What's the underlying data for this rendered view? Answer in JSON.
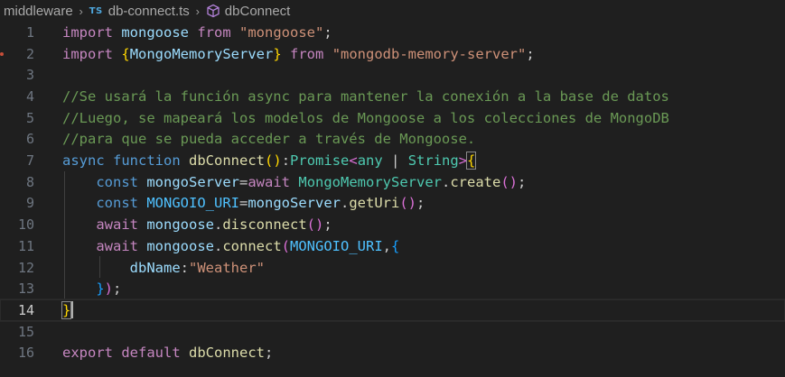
{
  "breadcrumb": {
    "folder": "middleware",
    "file_badge": "TS",
    "file": "db-connect.ts",
    "symbol": "dbConnect",
    "separator": "›"
  },
  "editor": {
    "current_line": 14,
    "line_numbers": [
      "1",
      "2",
      "3",
      "4",
      "5",
      "6",
      "7",
      "8",
      "9",
      "10",
      "11",
      "12",
      "13",
      "14",
      "15",
      "16"
    ],
    "lines": {
      "l1": {
        "t1": "import",
        "t2": " mongoose ",
        "t3": "from",
        "t4": " ",
        "t5": "\"mongoose\"",
        "t6": ";"
      },
      "l2": {
        "t1": "import",
        "t2": " ",
        "t3": "{",
        "t4": "MongoMemoryServer",
        "t5": "}",
        "t6": " ",
        "t7": "from",
        "t8": " ",
        "t9": "\"mongodb-memory-server\"",
        "t10": ";"
      },
      "l4": {
        "t1": "//Se usará la función async para mantener la conexión a la base de datos"
      },
      "l5": {
        "t1": "//Luego, se mapeará los modelos de Mongoose a los colecciones de MongoDB"
      },
      "l6": {
        "t1": "//para que se pueda acceder a través de Mongoose."
      },
      "l7": {
        "t1": "async",
        "t2": " ",
        "t3": "function",
        "t4": " ",
        "t5": "dbConnect",
        "t6": "()",
        "t7": ":",
        "t8": "Promise",
        "t9": "<",
        "t10": "any",
        "t11": " | ",
        "t12": "String",
        "t13": ">",
        "t14": "{"
      },
      "l8": {
        "t1": "const",
        "t2": " ",
        "t3": "mongoServer",
        "t4": "=",
        "t5": "await",
        "t6": " ",
        "t7": "MongoMemoryServer",
        "t8": ".",
        "t9": "create",
        "t10": "()",
        "t11": ";"
      },
      "l9": {
        "t1": "const",
        "t2": " ",
        "t3": "MONGOIO_URI",
        "t4": "=",
        "t5": "mongoServer",
        "t6": ".",
        "t7": "getUri",
        "t8": "()",
        "t9": ";"
      },
      "l10": {
        "t1": "await",
        "t2": " ",
        "t3": "mongoose",
        "t4": ".",
        "t5": "disconnect",
        "t6": "()",
        "t7": ";"
      },
      "l11": {
        "t1": "await",
        "t2": " ",
        "t3": "mongoose",
        "t4": ".",
        "t5": "connect",
        "t6": "(",
        "t7": "MONGOIO_URI",
        "t8": ",",
        "t9": "{"
      },
      "l12": {
        "t1": "dbName",
        "t2": ":",
        "t3": "\"Weather\""
      },
      "l13": {
        "t1": "}",
        "t2": ")",
        "t3": ";"
      },
      "l14": {
        "t1": "}"
      },
      "l16": {
        "t1": "export",
        "t2": " ",
        "t3": "default",
        "t4": " ",
        "t5": "dbConnect",
        "t6": ";"
      }
    }
  },
  "colors": {
    "background": "#1f1f1f",
    "keyword": "#569cd6",
    "control": "#c586c0",
    "string": "#ce9178",
    "variable": "#9cdcfe",
    "constant": "#4fc1ff",
    "function": "#dcdcaa",
    "type": "#4ec9b0",
    "comment": "#6a9955"
  }
}
